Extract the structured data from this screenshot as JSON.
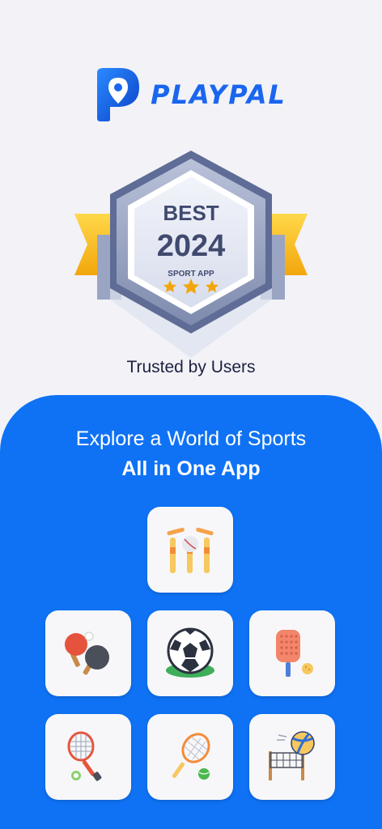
{
  "brand": {
    "name": "PLAYPAL",
    "accent": "#1a66ee"
  },
  "badge": {
    "title": "BEST",
    "year": "2024",
    "caption": "SPORT APP",
    "stars": 3
  },
  "tagline": "Trusted by Users",
  "panel": {
    "background": "#0f72f5",
    "headline": "Explore a World of Sports",
    "subheadline": "All in One App"
  },
  "sports": [
    {
      "name": "cricket",
      "icon": "cricket-stumps-icon"
    },
    {
      "name": "table-tennis",
      "icon": "table-tennis-paddles-icon"
    },
    {
      "name": "football",
      "icon": "soccer-ball-icon"
    },
    {
      "name": "pickleball",
      "icon": "pickleball-paddle-icon"
    },
    {
      "name": "badminton",
      "icon": "badminton-racket-icon"
    },
    {
      "name": "tennis",
      "icon": "tennis-racket-icon"
    },
    {
      "name": "volleyball",
      "icon": "volleyball-net-icon"
    }
  ]
}
